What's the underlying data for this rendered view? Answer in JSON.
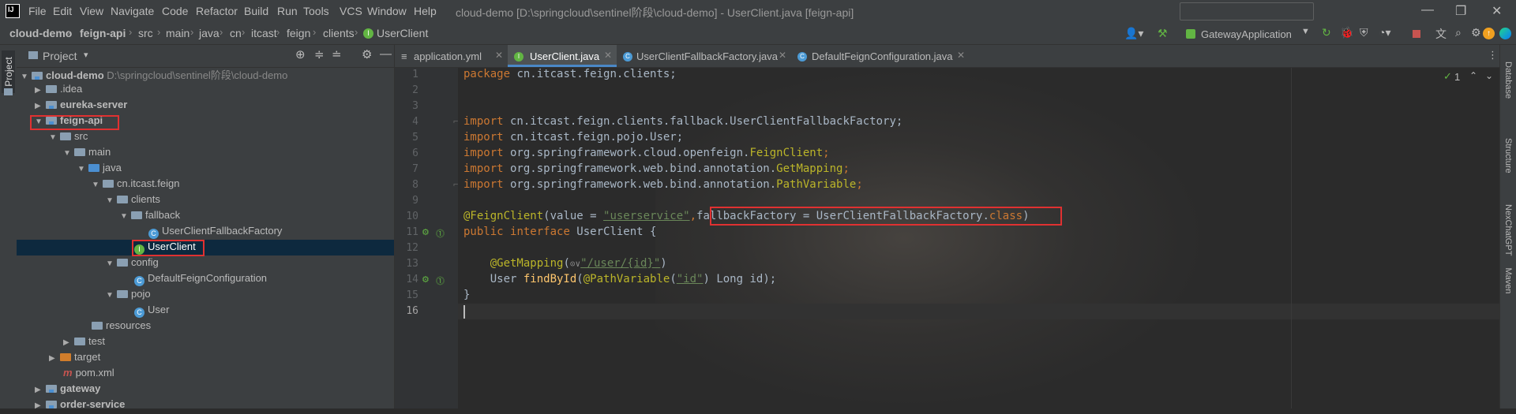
{
  "menu": [
    "File",
    "Edit",
    "View",
    "Navigate",
    "Code",
    "Refactor",
    "Build",
    "Run",
    "Tools",
    "VCS",
    "Window",
    "Help"
  ],
  "window_title": "cloud-demo [D:\\springcloud\\sentinel阶段\\cloud-demo] - UserClient.java [feign-api]",
  "breadcrumb": [
    "cloud-demo",
    "feign-api",
    "src",
    "main",
    "java",
    "cn",
    "itcast",
    "feign",
    "clients",
    "UserClient"
  ],
  "run_config": "GatewayApplication",
  "project_panel": {
    "title": "Project",
    "tree": [
      {
        "label": "cloud-demo",
        "path": "D:\\springcloud\\sentinel阶段\\cloud-demo"
      },
      {
        "label": ".idea"
      },
      {
        "label": "eureka-server"
      },
      {
        "label": "feign-api"
      },
      {
        "label": "src"
      },
      {
        "label": "main"
      },
      {
        "label": "java"
      },
      {
        "label": "cn.itcast.feign"
      },
      {
        "label": "clients"
      },
      {
        "label": "fallback"
      },
      {
        "label": "UserClientFallbackFactory"
      },
      {
        "label": "UserClient"
      },
      {
        "label": "config"
      },
      {
        "label": "DefaultFeignConfiguration"
      },
      {
        "label": "pojo"
      },
      {
        "label": "User"
      },
      {
        "label": "resources"
      },
      {
        "label": "test"
      },
      {
        "label": "target"
      },
      {
        "label": "pom.xml"
      },
      {
        "label": "gateway"
      },
      {
        "label": "order-service"
      }
    ]
  },
  "tabs": [
    {
      "label": "application.yml",
      "active": false
    },
    {
      "label": "UserClient.java",
      "active": true
    },
    {
      "label": "UserClientFallbackFactory.java",
      "active": false
    },
    {
      "label": "DefaultFeignConfiguration.java",
      "active": false
    }
  ],
  "editor": {
    "line_numbers": [
      "1",
      "2",
      "3",
      "4",
      "5",
      "6",
      "7",
      "8",
      "9",
      "10",
      "11",
      "12",
      "13",
      "14",
      "15",
      "16"
    ],
    "inspection_count": "1",
    "code": {
      "l1_kw": "package",
      "l1_rest": " cn.itcast.feign.clients;",
      "l4_rest": " cn.itcast.feign.clients.fallback.UserClientFallbackFactory;",
      "l5_rest": " cn.itcast.feign.pojo.User;",
      "l6_rest": " org.springframework.cloud.openfeign.",
      "l6_ann": "FeignClient",
      "l7_rest": " org.springframework.web.bind.annotation.",
      "l7_ann": "GetMapping",
      "l8_rest": " org.springframework.web.bind.annotation.",
      "l8_ann": "PathVariable",
      "import_kw": "import",
      "semi": ";",
      "l10_ann": "@FeignClient",
      "l10_a": "(value = ",
      "l10_str": "\"userservice\"",
      "l10_comma": ",",
      "l10_boxed": "fallbackFactory = UserClientFallbackFactory.",
      "l10_class": "class",
      "l10_close": ")",
      "l11_kw1": "public",
      "l11_kw2": "interface",
      "l11_rest": " UserClient {",
      "l13_ann": "@GetMapping",
      "l13_open": "(",
      "l13_glyph": "⊙∨",
      "l13_str": "\"/user/{id}\"",
      "l13_close": ")",
      "l14_a": "    User ",
      "l14_fn": "findById",
      "l14_b": "(",
      "l14_ann": "@PathVariable",
      "l14_c": "(",
      "l14_str": "\"id\"",
      "l14_d": ") Long id);",
      "l15": "}"
    }
  },
  "right_strip": [
    "Database",
    "Structure",
    "NexChatGPT",
    "Maven"
  ],
  "colors": {
    "keyword": "#cc7832",
    "string": "#6a8759",
    "annotation": "#bbb529",
    "highlight_box": "#e03131",
    "selection": "#0d293e"
  }
}
